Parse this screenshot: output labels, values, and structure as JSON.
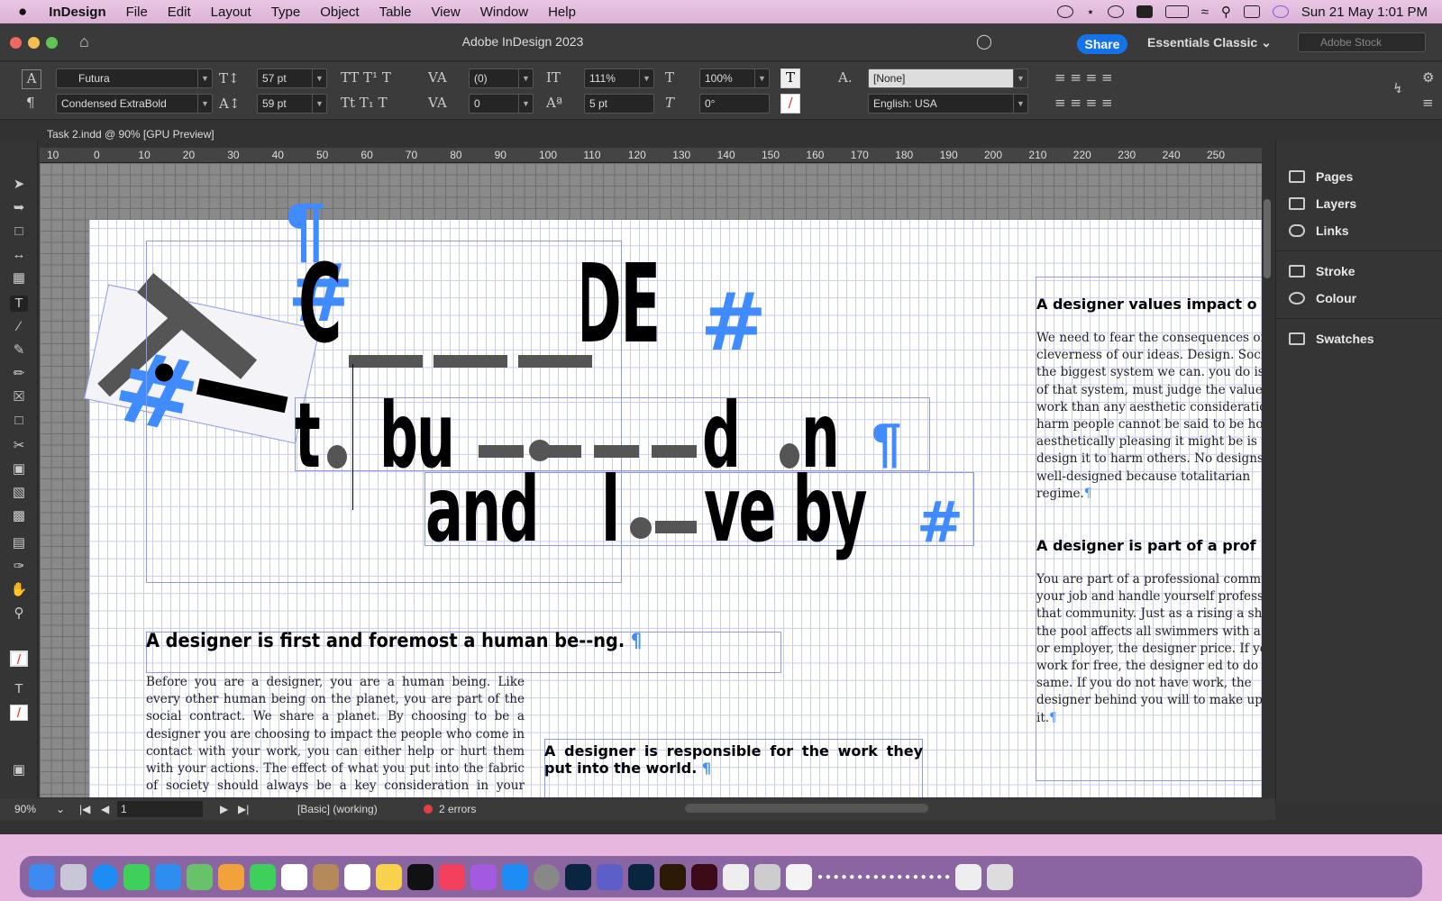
{
  "menubar": {
    "app": "InDesign",
    "items": [
      "File",
      "Edit",
      "Layout",
      "Type",
      "Object",
      "Table",
      "View",
      "Window",
      "Help"
    ],
    "clock": "Sun 21 May  1:01 PM"
  },
  "window": {
    "title": "Adobe InDesign 2023",
    "share": "Share",
    "workspace": "Essentials Classic",
    "stock_placeholder": "Adobe Stock"
  },
  "control": {
    "font": "Futura",
    "style": "Condensed ExtraBold",
    "size": "57 pt",
    "leading": "59 pt",
    "kerning": "(0)",
    "tracking": "0",
    "vscale": "111%",
    "hscale": "100%",
    "baseline": "5 pt",
    "skew": "0°",
    "charstyle": "[None]",
    "language": "English: USA"
  },
  "doc_tab": "Task 2.indd @ 90% [GPU Preview]",
  "ruler": [
    "10",
    "0",
    "10",
    "20",
    "30",
    "40",
    "50",
    "60",
    "70",
    "80",
    "90",
    "100",
    "110",
    "120",
    "130",
    "140",
    "150",
    "160",
    "170",
    "180",
    "190",
    "200",
    "210",
    "220",
    "230",
    "240",
    "250"
  ],
  "canvas": {
    "head_main": "A designer is first and foremost a human be--ng.",
    "body_main": "Before you are a designer, you are a human being. Like every other human being on the planet, you are part of the social contract. We share a planet. By choosing to be a designer you are choosing to impact the people who come in contact with your work, you can either help or hurt them with your actions. The effect of what you put into the fabric of society should always be a key consideration in your work. Every human",
    "head_resp": "A designer is responsible for the work they put into the world.",
    "head_values": "A designer values impact o",
    "body_values": "We need to fear the consequences of the cleverness of our ideas. Design. Society is the biggest system we can. you do is a part of that system, must judge the value of our work than any aesthetic consideration. to harm people cannot be said to be how aesthetically pleasing it might be is to design it to harm others. No designs is well-designed because totalitarian regime.",
    "head_part": "A designer is part of a prof",
    "body_part": "You are part of a professional community. your job and handle yourself professionally that community. Just as a rising a shit in the pool affects all swimmers with a client or employer, the designer price. If you work for free, the designer ed to do the same. If you do not have work, the designer behind you will to make up for it.",
    "big1": "C DE",
    "big2": "t bu d n",
    "big3": "and l ve by"
  },
  "panels": [
    "Pages",
    "Layers",
    "Links",
    "Stroke",
    "Colour",
    "Swatches"
  ],
  "status": {
    "zoom": "90%",
    "page": "1",
    "style": "[Basic] (working)",
    "errors": "2 errors"
  }
}
